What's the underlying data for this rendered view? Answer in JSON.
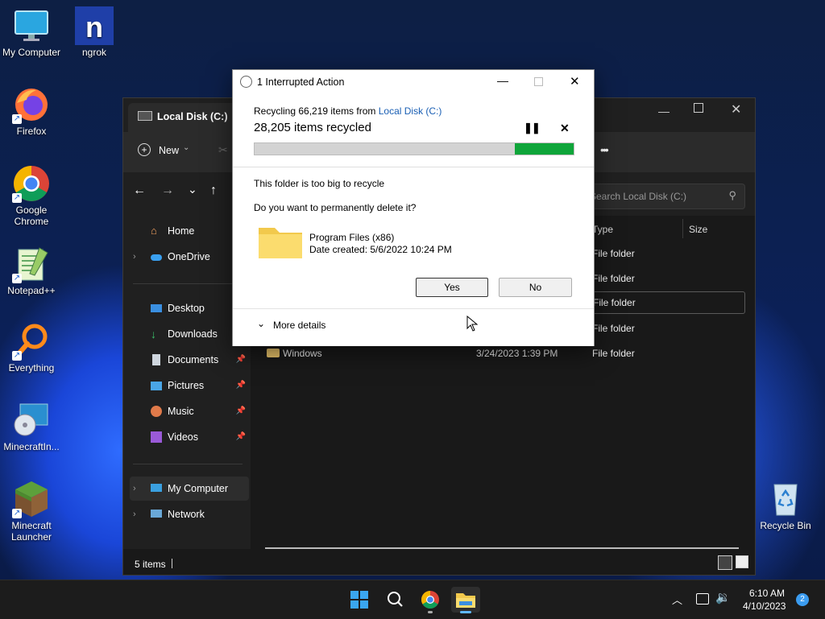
{
  "desktop": {
    "icons": [
      {
        "label": "My Computer"
      },
      {
        "label": "ngrok"
      },
      {
        "label": "Firefox"
      },
      {
        "label": "Google Chrome"
      },
      {
        "label": "Notepad++"
      },
      {
        "label": "Everything"
      },
      {
        "label": "MinecraftIn..."
      },
      {
        "label": "Minecraft Launcher"
      },
      {
        "label": "Recycle Bin"
      }
    ]
  },
  "explorer": {
    "tab_title": "Local Disk (C:)",
    "toolbar": {
      "new_label": "New",
      "more_label": "•••"
    },
    "search_placeholder": "Search Local Disk (C:)",
    "nav": {
      "home": "Home",
      "onedrive": "OneDrive",
      "desktop": "Desktop",
      "downloads": "Downloads",
      "documents": "Documents",
      "pictures": "Pictures",
      "music": "Music",
      "videos": "Videos",
      "my_computer": "My Computer",
      "network": "Network"
    },
    "columns": {
      "type": "Type",
      "size": "Size"
    },
    "rows": [
      {
        "name": "",
        "date": "",
        "type": "File folder"
      },
      {
        "name": "",
        "date": "",
        "type": "File folder"
      },
      {
        "name": "",
        "date": "",
        "type": "File folder"
      },
      {
        "name": "",
        "date": "",
        "type": "File folder"
      },
      {
        "name": "Windows",
        "date": "3/24/2023 1:39 PM",
        "type": "File folder"
      }
    ],
    "status": "5 items"
  },
  "dialog": {
    "title": "1 Interrupted Action",
    "recycling_prefix": "Recycling 66,219 items from ",
    "recycling_link": "Local Disk (C:)",
    "items_recycled": "28,205 items recycled",
    "progress": 0.816,
    "message": "This folder is too big to recycle",
    "question": "Do you want to permanently delete it?",
    "file_name": "Program Files (x86)",
    "file_date": "Date created: 5/6/2022 10:24 PM",
    "yes_label": "Yes",
    "no_label": "No",
    "more_details": "More details"
  },
  "taskbar": {
    "time": "6:10 AM",
    "date": "4/10/2023",
    "notification_count": "2"
  }
}
